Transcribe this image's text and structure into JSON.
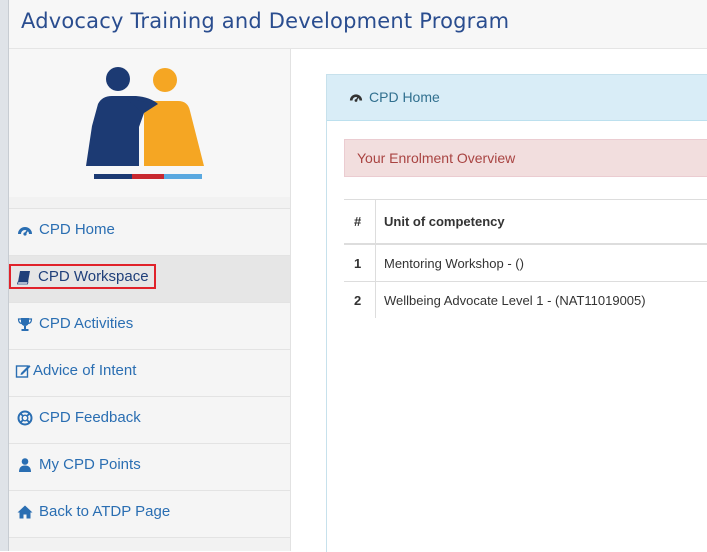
{
  "header": {
    "title": "Advocacy Training and Development Program"
  },
  "sidebar": {
    "logo": {
      "icon": "atdp-logo",
      "colors": {
        "navy": "#1c3a73",
        "orange": "#f5a623",
        "red": "#c8282f",
        "blue": "#5aa9e0"
      }
    },
    "items": [
      {
        "label": "CPD Home",
        "icon": "dashboard-icon",
        "active": false
      },
      {
        "label": "CPD Workspace",
        "icon": "book-icon",
        "active": true,
        "highlighted": true
      },
      {
        "label": "CPD Activities",
        "icon": "trophy-icon",
        "active": false
      },
      {
        "label": "Advice of Intent",
        "icon": "edit-icon",
        "active": false
      },
      {
        "label": "CPD Feedback",
        "icon": "lifebuoy-icon",
        "active": false
      },
      {
        "label": "My CPD Points",
        "icon": "user-icon",
        "active": false
      },
      {
        "label": "Back to ATDP Page",
        "icon": "home-icon",
        "active": false
      }
    ]
  },
  "main": {
    "panel_title": "CPD Home",
    "panel_icon": "dashboard-icon",
    "alert": "Your Enrolment Overview",
    "table": {
      "headers": [
        "#",
        "Unit of competency"
      ],
      "rows": [
        {
          "num": "1",
          "unit": "Mentoring Workshop - ()"
        },
        {
          "num": "2",
          "unit": "Wellbeing Advocate Level 1 - (NAT11019005)"
        }
      ]
    }
  },
  "colors": {
    "link": "#2a6eb2",
    "title": "#2a4d8f",
    "panel_head": "#d9edf7",
    "alert_bg": "#f2dede",
    "alert_text": "#a94442",
    "highlight": "#e0222a"
  }
}
